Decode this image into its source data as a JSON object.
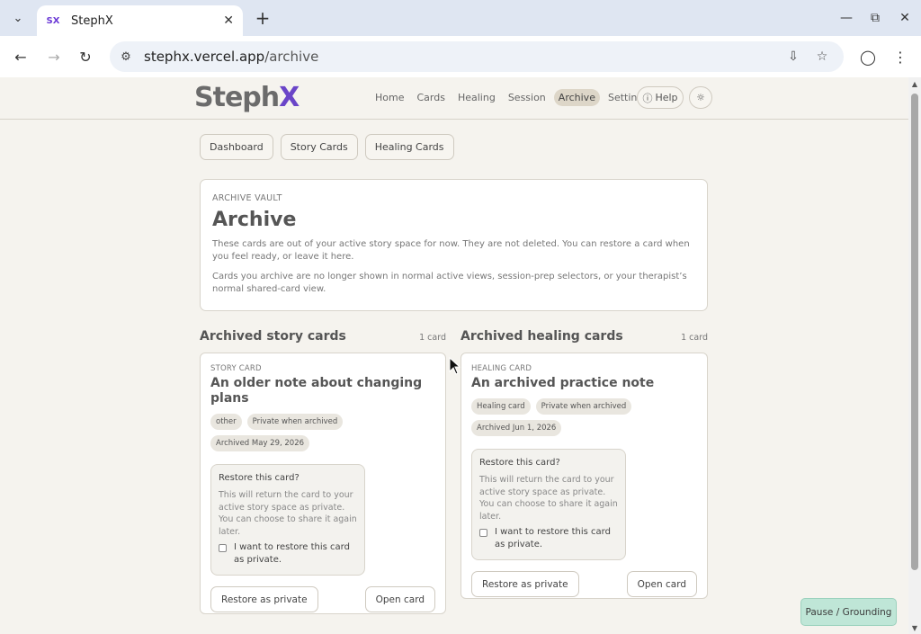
{
  "browser": {
    "tab_title": "StephX",
    "favicon_text": "SX",
    "url_host": "stephx.vercel.app",
    "url_path": "/archive"
  },
  "header": {
    "logo_main": "Steph",
    "logo_accent": "X",
    "nav": [
      "Home",
      "Cards",
      "Healing",
      "Session",
      "Archive",
      "Settings"
    ],
    "active_nav": "Archive",
    "help_label": "Help"
  },
  "subnav": [
    "Dashboard",
    "Story Cards",
    "Healing Cards"
  ],
  "vault": {
    "eyebrow": "ARCHIVE VAULT",
    "title": "Archive",
    "para1": "These cards are out of your active story space for now. They are not deleted. You can restore a card when you feel ready, or leave it here.",
    "para2": "Cards you archive are no longer shown in normal active views, session-prep selectors, or your therapist’s normal shared-card view."
  },
  "story_col": {
    "title": "Archived story cards",
    "count": "1 card",
    "card": {
      "type": "STORY CARD",
      "title": "An older note about changing plans",
      "chips": [
        "other",
        "Private when archived",
        "Archived May 29, 2026"
      ],
      "restore_title": "Restore this card?",
      "restore_desc": "This will return the card to your active story space as private. You can choose to share it again later.",
      "checkbox_label": "I want to restore this card as private.",
      "restore_btn": "Restore as private",
      "open_btn": "Open card"
    }
  },
  "healing_col": {
    "title": "Archived healing cards",
    "count": "1 card",
    "card": {
      "type": "HEALING CARD",
      "title": "An archived practice note",
      "chips": [
        "Healing card",
        "Private when archived",
        "Archived Jun 1, 2026"
      ],
      "restore_title": "Restore this card?",
      "restore_desc": "This will return the card to your active story space as private. You can choose to share it again later.",
      "checkbox_label": "I want to restore this card as private.",
      "restore_btn": "Restore as private",
      "open_btn": "Open card"
    }
  },
  "pause_label": "Pause / Grounding",
  "colors": {
    "accent": "#6a45c8",
    "pause_bg": "#bfe6d7",
    "page_bg": "#f5f3ee"
  }
}
